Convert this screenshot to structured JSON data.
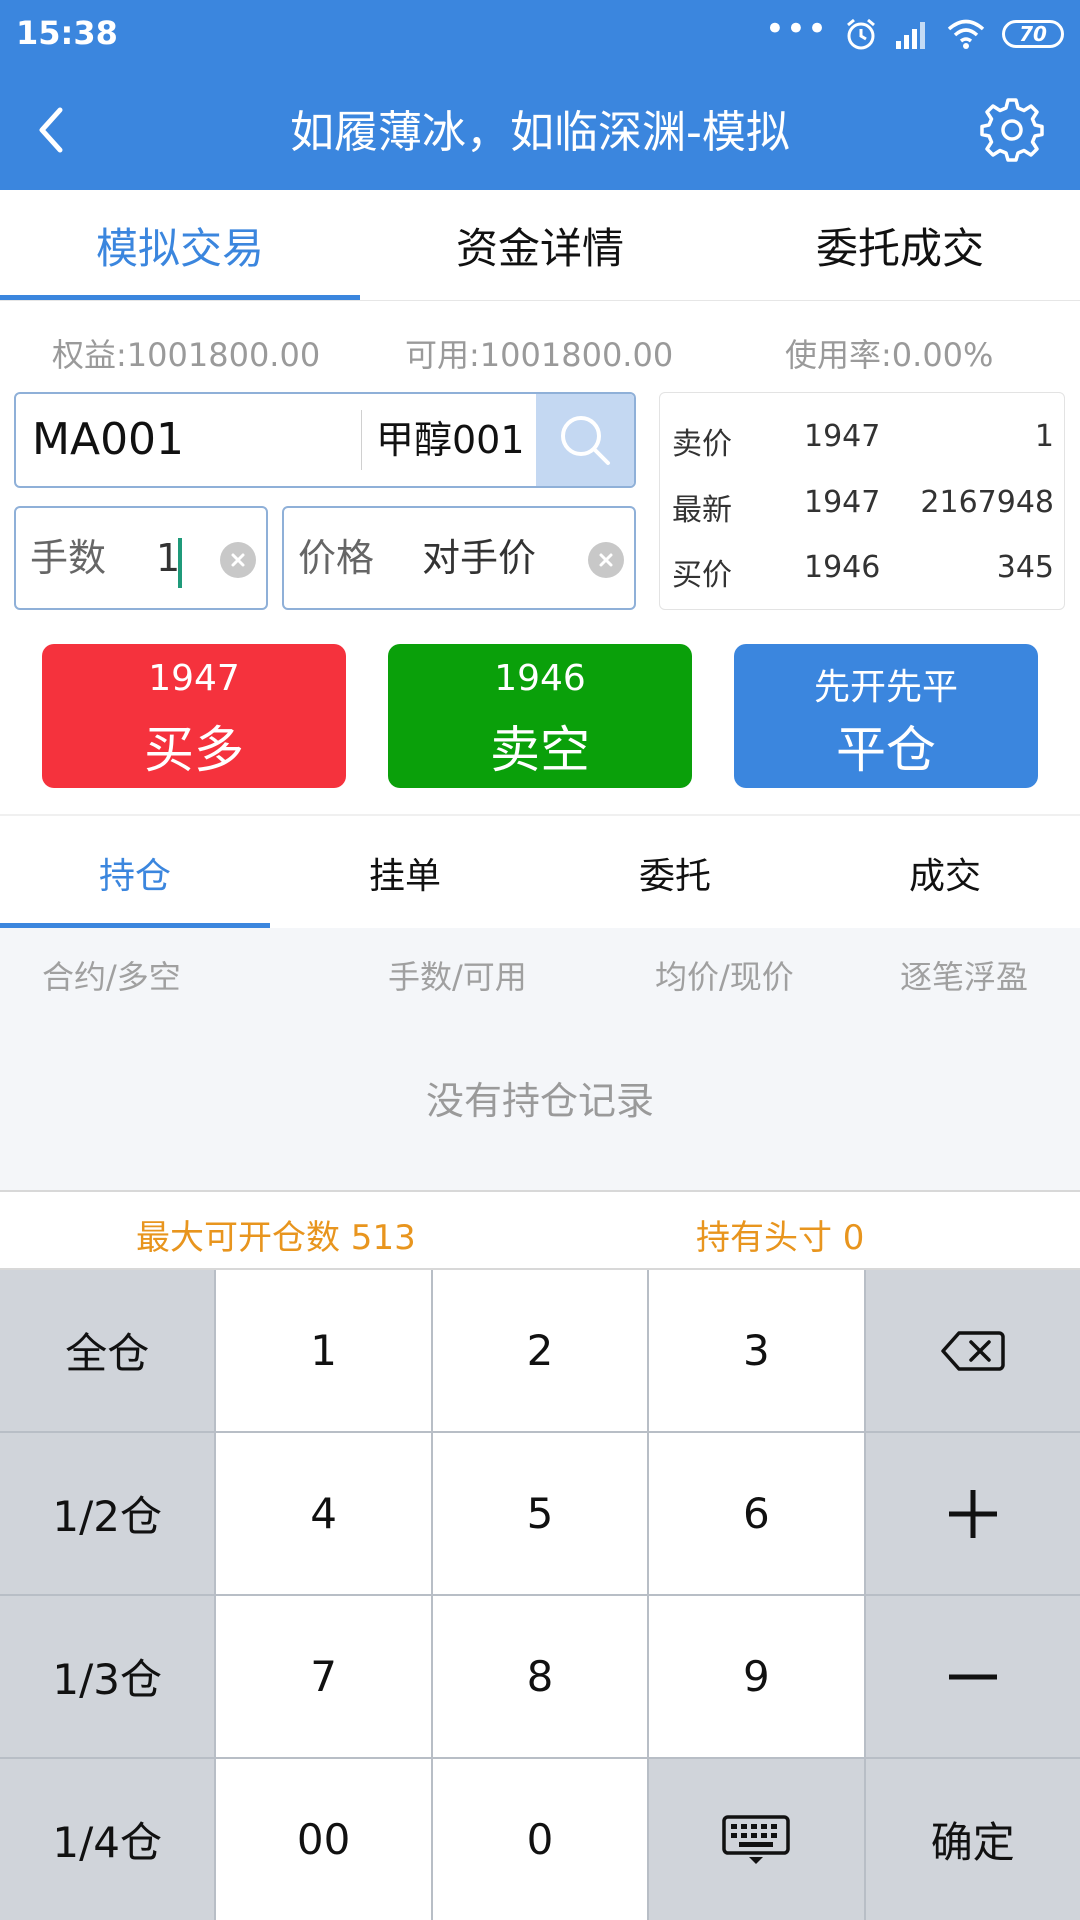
{
  "status_bar": {
    "time": "15:38",
    "battery": "70"
  },
  "header": {
    "title": "如履薄冰，如临深渊-模拟"
  },
  "tabs": [
    {
      "label": "模拟交易"
    },
    {
      "label": "资金详情"
    },
    {
      "label": "委托成交"
    }
  ],
  "account": {
    "equity": "权益:1001800.00",
    "available": "可用:1001800.00",
    "usage": "使用率:0.00%"
  },
  "contract": {
    "code": "MA001",
    "name": "甲醇001"
  },
  "order": {
    "lots_label": "手数",
    "lots_value": "1",
    "price_label": "价格",
    "price_value": "对手价"
  },
  "quote": [
    {
      "label": "卖价",
      "price": "1947",
      "volume": "1"
    },
    {
      "label": "最新",
      "price": "1947",
      "volume": "2167948"
    },
    {
      "label": "买价",
      "price": "1946",
      "volume": "345"
    }
  ],
  "actions": {
    "buy": {
      "price": "1947",
      "label": "买多"
    },
    "sell": {
      "price": "1946",
      "label": "卖空"
    },
    "close": {
      "price": "先开先平",
      "label": "平仓"
    }
  },
  "position_tabs": [
    {
      "label": "持仓"
    },
    {
      "label": "挂单"
    },
    {
      "label": "委托"
    },
    {
      "label": "成交"
    }
  ],
  "position_columns": [
    "合约/多空",
    "手数/可用",
    "均价/现价",
    "逐笔浮盈"
  ],
  "position_empty": "没有持仓记录",
  "info": {
    "max_open": "最大可开仓数 513",
    "holding": "持有头寸 0"
  },
  "keypad": {
    "full": "全仓",
    "half": "1/2仓",
    "third": "1/3仓",
    "quarter": "1/4仓",
    "k1": "1",
    "k2": "2",
    "k3": "3",
    "k4": "4",
    "k5": "5",
    "k6": "6",
    "k7": "7",
    "k8": "8",
    "k9": "9",
    "k00": "00",
    "k0": "0",
    "confirm": "确定"
  },
  "colors": {
    "primary": "#3b86de",
    "buy": "#f5323d",
    "sell": "#0aa00a",
    "info": "#e8951e"
  }
}
